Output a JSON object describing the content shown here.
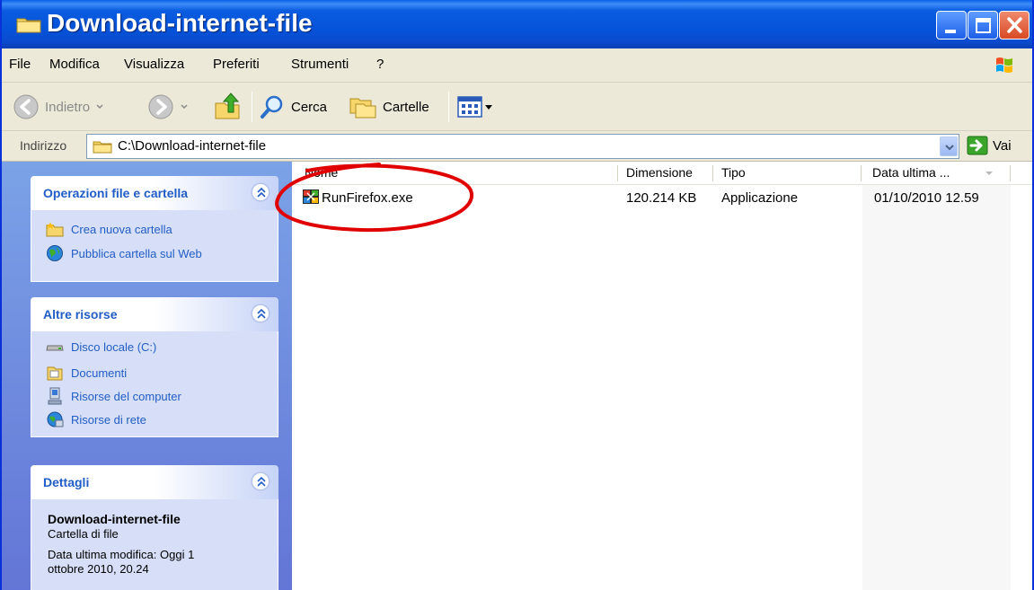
{
  "window": {
    "title": "Download-internet-file"
  },
  "menu": {
    "items": [
      "File",
      "Modifica",
      "Visualizza",
      "Preferiti",
      "Strumenti",
      "?"
    ]
  },
  "toolbar": {
    "back_label": "Indietro",
    "search_label": "Cerca",
    "folders_label": "Cartelle"
  },
  "address": {
    "label": "Indirizzo",
    "value": "C:\\Download-internet-file",
    "go_label": "Vai"
  },
  "taskpane": {
    "file_ops": {
      "title": "Operazioni file e cartella",
      "items": [
        "Crea nuova cartella",
        "Pubblica cartella sul Web"
      ]
    },
    "other": {
      "title": "Altre risorse",
      "items": [
        "Disco locale (C:)",
        "Documenti",
        "Risorse del computer",
        "Risorse di rete"
      ]
    },
    "details": {
      "title": "Dettagli",
      "name": "Download-internet-file",
      "type": "Cartella di file",
      "modified_line1": "Data ultima modifica: Oggi 1",
      "modified_line2": "ottobre 2010, 20.24"
    }
  },
  "filelist": {
    "columns": [
      "Nome",
      "Dimensione",
      "Tipo",
      "Data ultima ..."
    ],
    "rows": [
      {
        "name": "RunFirefox.exe",
        "size": "120.214 KB",
        "type": "Applicazione",
        "modified": "01/10/2010 12.59"
      }
    ]
  },
  "colors": {
    "annotation": "#e00000",
    "link": "#215dc6"
  }
}
